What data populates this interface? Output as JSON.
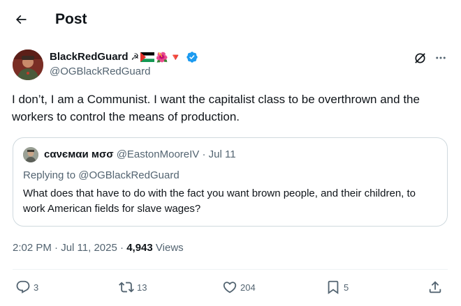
{
  "header": {
    "title": "Post",
    "back_icon": "arrow-left-icon"
  },
  "author": {
    "display_name": "BlackRedGuard",
    "emoji_sickle": "☭",
    "emoji_flower": "🌺",
    "emoji_triangle": "🔻",
    "handle": "@OGBlackRedGuard",
    "verified_color": "#1d9bf0"
  },
  "post": {
    "text": "I don’t, I am a Communist. I want the capitalist class to be overthrown and the workers to control the means of production."
  },
  "quote": {
    "display_name": "сανємαи мσσ",
    "handle": "@EastonMooreIV",
    "separator": "·",
    "date": "Jul 11",
    "replying_to": "Replying to @OGBlackRedGuard",
    "text": "What does that have to do with the fact you want brown people, and their children, to work American fields for slave wages?"
  },
  "meta": {
    "time": "2:02 PM",
    "separator": "·",
    "date": "Jul 11, 2025",
    "separator2": "·",
    "views_count": "4,943",
    "views_label": "Views"
  },
  "actions": {
    "replies": "3",
    "reposts": "13",
    "likes": "204",
    "bookmarks": "5"
  },
  "colors": {
    "text": "#0f1419",
    "secondary": "#536471",
    "border": "#cfd9de",
    "accent": "#1d9bf0"
  }
}
